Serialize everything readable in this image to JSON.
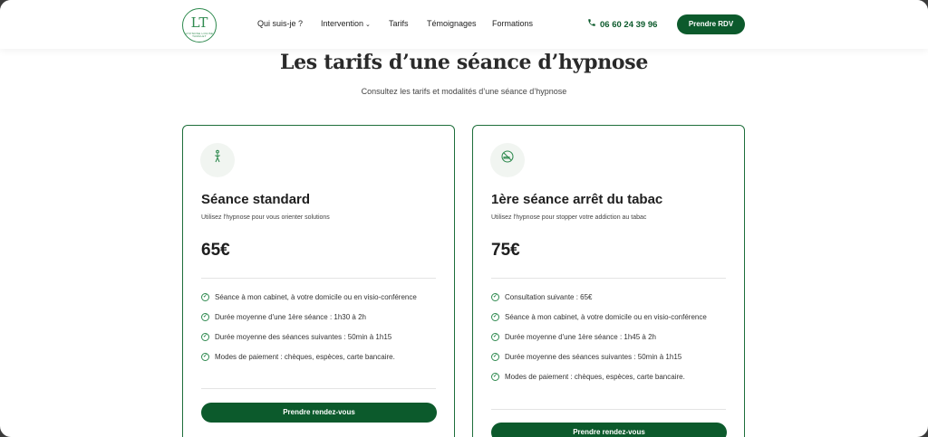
{
  "header": {
    "logo_text": "LT",
    "logo_subtext": "HYPNOSE LOUISE TAMALET",
    "nav": [
      {
        "label": "Qui suis-je ?"
      },
      {
        "label": "Intervention",
        "has_dropdown": true
      },
      {
        "label": "Tarifs"
      },
      {
        "label": "Témoignages"
      },
      {
        "label": "Formations"
      }
    ],
    "phone": "06 60 24 39 96",
    "cta_label": "Prendre RDV"
  },
  "page": {
    "title": "Les tarifs d’une séance d’hypnose",
    "subtitle": "Consultez les tarifs et modalités d’une séance d’hypnose"
  },
  "cards": [
    {
      "icon": "person-relax-icon",
      "title": "Séance standard",
      "description": "Utilisez l'hypnose pour vous orienter solutions",
      "price": "65€",
      "features": [
        "Séance à mon cabinet, à votre domicile ou en visio-conférence",
        "Durée moyenne d'une 1ère séance : 1h30 à 2h",
        "Durée moyenne des séances suivantes : 50min à 1h15",
        "Modes de paiement : chèques, espèces, carte bancaire."
      ],
      "button_label": "Prendre rendez-vous"
    },
    {
      "icon": "no-smoking-icon",
      "title": "1ère séance arrêt du tabac",
      "description": "Utilisez l'hypnose pour stopper votre addiction au tabac",
      "price": "75€",
      "features": [
        "Consultation suivante : 65€",
        "Séance à mon cabinet, à votre domicile ou en visio-conférence",
        "Durée moyenne d'une 1ère séance : 1h45 à 2h",
        "Durée moyenne des séances suivantes : 50min à 1h15",
        "Modes de paiement : chèques, espèces, carte bancaire."
      ],
      "button_label": "Prendre rendez-vous"
    }
  ],
  "colors": {
    "brand_green": "#0c5a2c",
    "accent_green": "#2f8a4f",
    "card_border": "#1e6e3b"
  }
}
